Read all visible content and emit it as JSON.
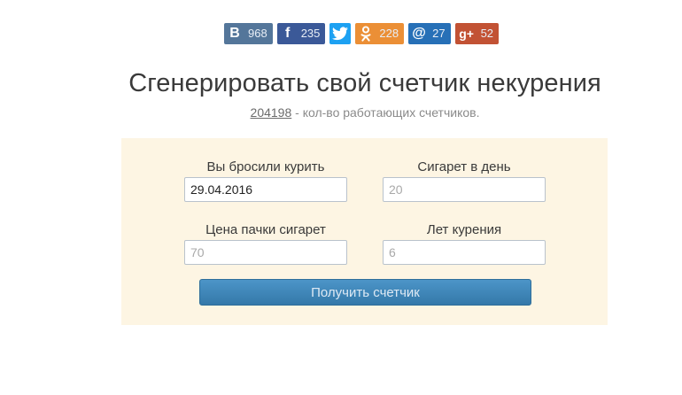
{
  "share": {
    "vk": {
      "icon": "vk-icon",
      "glyph": "В",
      "count": "968"
    },
    "facebook": {
      "icon": "facebook-icon",
      "glyph": "f",
      "count": "235"
    },
    "twitter": {
      "icon": "twitter-icon",
      "glyph": "🐦"
    },
    "odnoklassniki": {
      "icon": "odnoklassniki-icon",
      "glyph": "ᴏ",
      "count": "228"
    },
    "mailru": {
      "icon": "mailru-icon",
      "glyph": "@",
      "count": "27"
    },
    "googleplus": {
      "icon": "googleplus-icon",
      "glyph": "g+",
      "count": "52"
    }
  },
  "page": {
    "title": "Сгенерировать свой счетчик некурения",
    "counter_link": "204198",
    "counter_text": " - кол-во работающих счетчиков."
  },
  "form": {
    "quit_date": {
      "label": "Вы бросили курить",
      "value": "29.04.2016"
    },
    "cigarettes_per_day": {
      "label": "Сигарет в день",
      "placeholder": "20"
    },
    "pack_price": {
      "label": "Цена пачки сигарет",
      "placeholder": "70"
    },
    "years_smoking": {
      "label": "Лет курения",
      "placeholder": "6"
    },
    "submit_label": "Получить счетчик"
  },
  "colors": {
    "panel_bg": "#fdf5e3",
    "button": "#3f88bb"
  }
}
